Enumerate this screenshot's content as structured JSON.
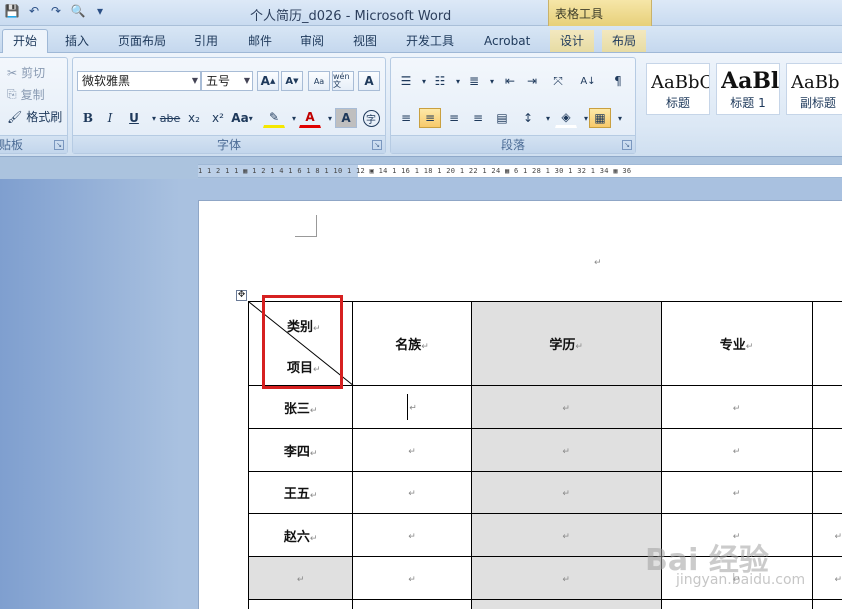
{
  "window": {
    "title": "个人简历_d026 - Microsoft Word",
    "context_tools": "表格工具"
  },
  "tabs": [
    "开始",
    "插入",
    "页面布局",
    "引用",
    "邮件",
    "审阅",
    "视图",
    "开发工具",
    "Acrobat",
    "设计",
    "布局"
  ],
  "clipboard": {
    "cut": "剪切",
    "copy": "复制",
    "format_painter": "格式刷",
    "label": "贴板"
  },
  "font": {
    "name": "微软雅黑",
    "size": "五号",
    "label": "字体",
    "grow": "A",
    "shrink": "A",
    "wen": "wén 文",
    "bold": "B",
    "italic": "I",
    "underline": "U",
    "strike": "abe",
    "sub": "x₂",
    "sup": "x²",
    "case": "Aa",
    "color_a": "A",
    "shade_a": "A",
    "enclose": "字"
  },
  "paragraph": {
    "label": "段落"
  },
  "styles": [
    {
      "sample": "AaBbC",
      "name": "标题"
    },
    {
      "sample": "AaBl",
      "name": "标题 1"
    },
    {
      "sample": "AaBb",
      "name": "副标题"
    }
  ],
  "ruler": {
    "ticks": "1 1 2 1 1 ▦ 1 2 1 4 1 6 1 8 1 10 1 12 ▣ 14 1 16 1 18 1 20 1 22 1 24 ▦ 6 1 28 1 30 1 32 1 34 ▦ 36"
  },
  "table": {
    "header_diag_top": "类别",
    "header_diag_bottom": "项目",
    "columns": [
      "名族",
      "学历",
      "专业"
    ],
    "rows": [
      "张三",
      "李四",
      "王五",
      "赵六",
      ""
    ]
  },
  "marks": {
    "para": "↵"
  },
  "watermark": {
    "text": "Bai 经验",
    "sub": "jingyan.baidu.com"
  },
  "colors": {
    "accent": "#d62020",
    "shade": "#e0e0e0"
  }
}
